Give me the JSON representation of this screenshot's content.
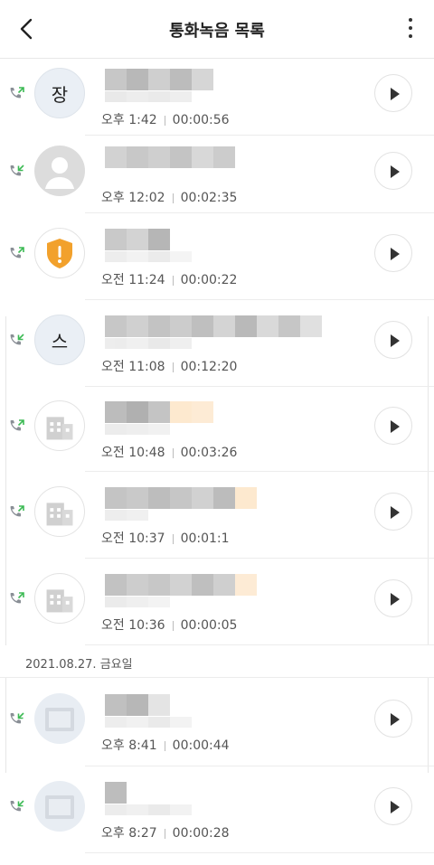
{
  "header": {
    "title": "통화녹음 목록"
  },
  "colors": {
    "outgoing_arrow": "#3cba54",
    "incoming_arrow": "#3cba54",
    "phone": "#8a8f96",
    "shield": "#f2a12c"
  },
  "date_separator": "2021.08.27. 금요일",
  "calls": [
    {
      "avatar_type": "letter",
      "avatar_text": "장",
      "direction": "outgoing",
      "time": "오후 1:42",
      "duration": "00:00:56"
    },
    {
      "avatar_type": "person",
      "avatar_text": "",
      "direction": "incoming",
      "time": "오후 12:02",
      "duration": "00:02:35"
    },
    {
      "avatar_type": "shield",
      "avatar_text": "",
      "direction": "outgoing",
      "time": "오전 11:24",
      "duration": "00:00:22"
    },
    {
      "avatar_type": "letter",
      "avatar_text": "스",
      "direction": "incoming",
      "time": "오전 11:08",
      "duration": "00:12:20"
    },
    {
      "avatar_type": "building",
      "avatar_text": "",
      "direction": "outgoing",
      "time": "오전 10:48",
      "duration": "00:03:26"
    },
    {
      "avatar_type": "building",
      "avatar_text": "",
      "direction": "outgoing",
      "time": "오전 10:37",
      "duration": "00:01:1"
    },
    {
      "avatar_type": "building",
      "avatar_text": "",
      "direction": "outgoing",
      "time": "오전 10:36",
      "duration": "00:00:05"
    },
    {
      "avatar_type": "photo",
      "avatar_text": "",
      "direction": "incoming",
      "time": "오후 8:41",
      "duration": "00:00:44"
    },
    {
      "avatar_type": "photo",
      "avatar_text": "",
      "direction": "incoming",
      "time": "오후 8:27",
      "duration": "00:00:28"
    }
  ]
}
